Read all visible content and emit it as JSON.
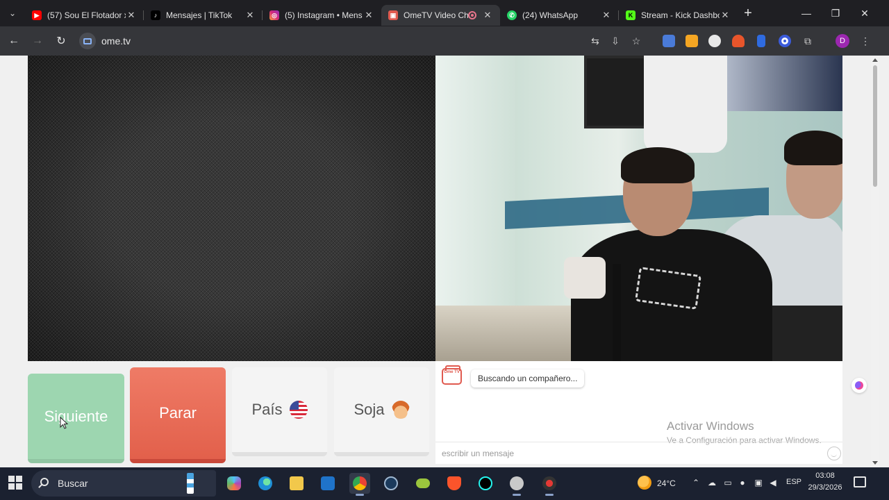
{
  "browser": {
    "tabs": [
      {
        "title": "(57) Sou El Flotador x",
        "fav_color": "#ff0000",
        "fav_glyph": "▶",
        "active": false
      },
      {
        "title": "Mensajes | TikTok",
        "fav_color": "#000000",
        "fav_glyph": "♪",
        "active": false
      },
      {
        "title": "(5) Instagram • Mens",
        "fav_color": "#d62976",
        "fav_glyph": "◎",
        "active": false
      },
      {
        "title": "OmeTV Video Ch",
        "fav_color": "#e05a4f",
        "fav_glyph": "▣",
        "active": true
      },
      {
        "title": "(24) WhatsApp",
        "fav_color": "#25d366",
        "fav_glyph": "✆",
        "active": false
      },
      {
        "title": "Stream - Kick Dashbo",
        "fav_color": "#53fc18",
        "fav_glyph": "K",
        "active": false
      }
    ],
    "url": "ome.tv"
  },
  "ometv": {
    "buttons": {
      "next": "Siguiente",
      "stop": "Parar",
      "country": "País",
      "gender": "Soja"
    },
    "chat": {
      "status_message": "Buscando un compañero...",
      "input_placeholder": "escribir un mensaje",
      "logo_text": "Ome TV"
    }
  },
  "windows_watermark": {
    "line1": "Activar Windows",
    "line2": "Ve a Configuración para activar Windows."
  },
  "taskbar": {
    "search_placeholder": "Buscar",
    "temperature": "24°C",
    "language": "ESP",
    "time": "03:08",
    "date": "29/3/2026"
  },
  "colors": {
    "next_button": "#9dd6b0",
    "stop_button": "#e8654f",
    "accent": "#e05a4f"
  }
}
